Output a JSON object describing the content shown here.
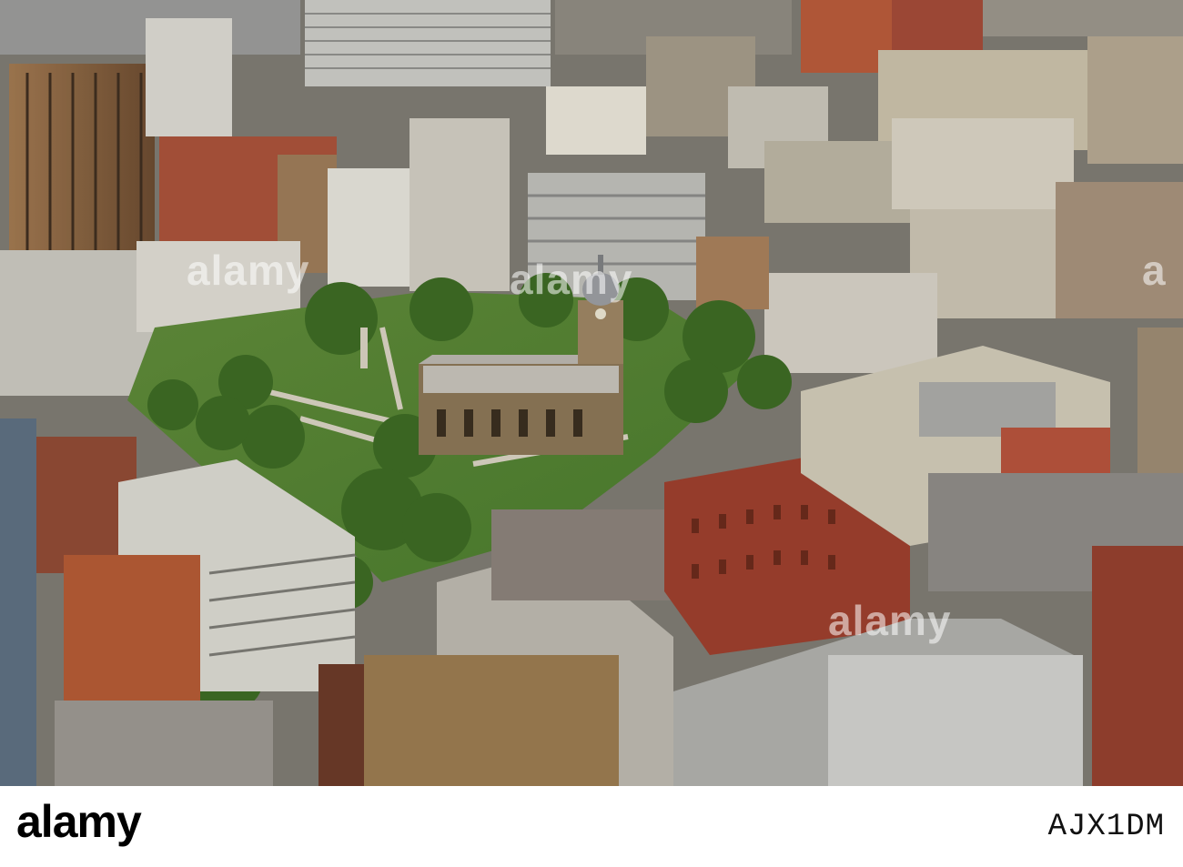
{
  "photo": {
    "description_label": "aerial-city-cathedral-square",
    "watermarks": [
      "alamy",
      "alamy",
      "alamy",
      "a"
    ]
  },
  "footer": {
    "logo_text": "alamy",
    "image_id": "AJX1DM"
  }
}
